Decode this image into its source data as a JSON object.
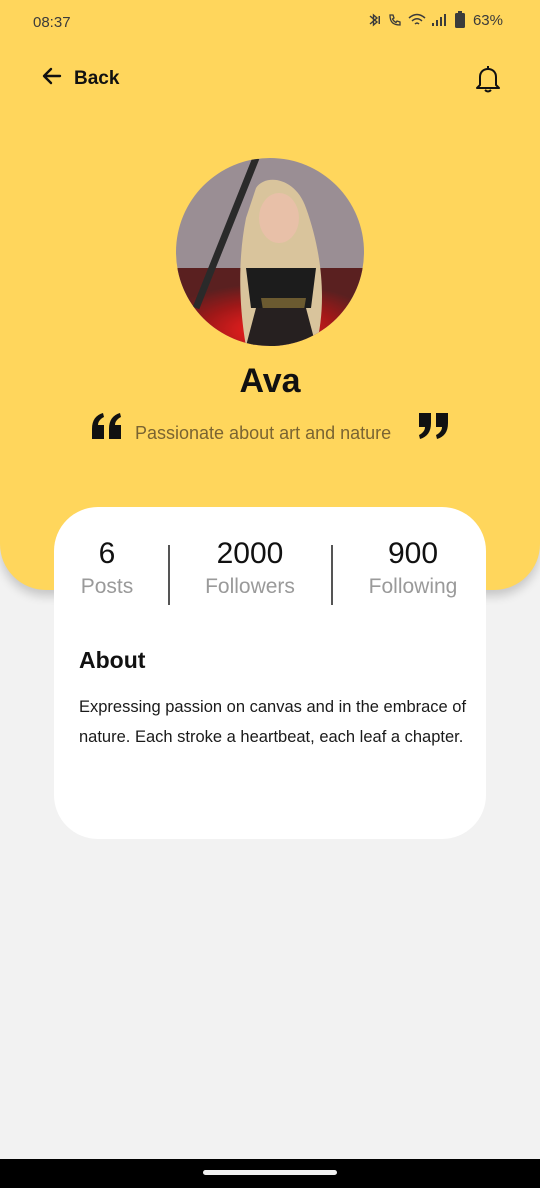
{
  "status_bar": {
    "time": "08:37",
    "battery": "63%"
  },
  "header": {
    "back_label": "Back",
    "bell_icon": "bell-icon"
  },
  "profile": {
    "name": "Ava",
    "tagline": "Passionate about art and nature"
  },
  "stats": [
    {
      "value": "6",
      "label": "Posts"
    },
    {
      "value": "2000",
      "label": "Followers"
    },
    {
      "value": "900",
      "label": "Following"
    }
  ],
  "about": {
    "title": "About",
    "body": "Expressing passion on canvas and in the embrace of nature. Each stroke a heartbeat, each leaf a chapter."
  },
  "colors": {
    "accent": "#ffd65c",
    "background": "#f2f2f2",
    "card": "#ffffff"
  }
}
